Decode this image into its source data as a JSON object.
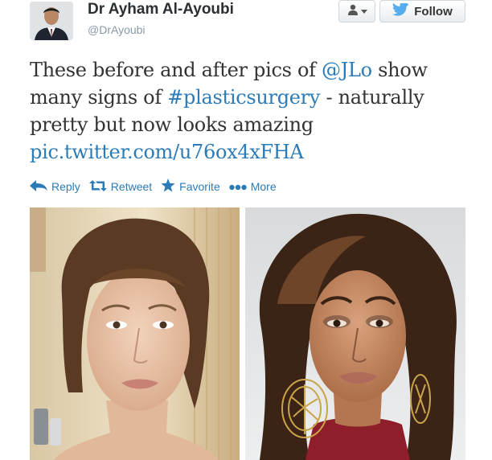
{
  "header": {
    "display_name": "Dr Ayham Al-Ayoubi",
    "handle": "@DrAyoubi",
    "follow_label": "Follow"
  },
  "tweet": {
    "text_part1": "These before and after pics of ",
    "mention": "@JLo",
    "text_part2": " show many signs of ",
    "hashtag": "#plasticsurgery",
    "text_part3": " - naturally pretty but now looks amazing",
    "link": "pic.twitter.com/u76ox4xFHA"
  },
  "actions": {
    "reply": "Reply",
    "retweet": "Retweet",
    "favorite": "Favorite",
    "more": "More"
  },
  "colors": {
    "link": "#2b7bb9",
    "text": "#333333",
    "follow_bird": "#55acee"
  },
  "icons": [
    "user-icon",
    "caret-down-icon",
    "twitter-bird-icon",
    "reply-icon",
    "retweet-icon",
    "star-icon",
    "more-dots-icon"
  ]
}
